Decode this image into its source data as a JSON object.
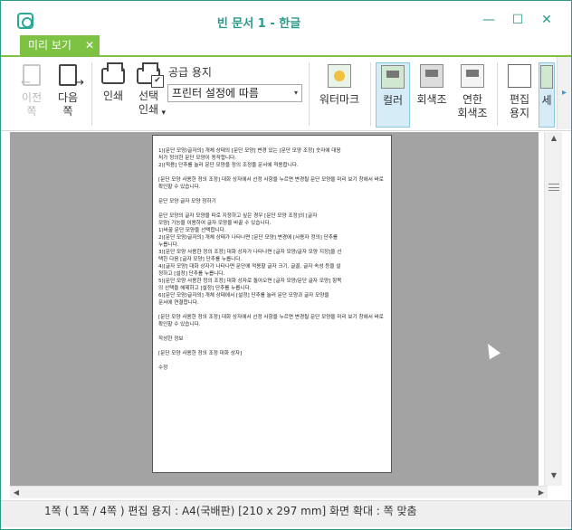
{
  "window": {
    "title": "빈 문서 1 - 한글",
    "controls": {
      "minimize": "—",
      "maximize": "☐",
      "close": "✕"
    }
  },
  "tab": {
    "label": "미리 보기",
    "close": "✕"
  },
  "ribbon": {
    "prev": "이전\n쪽",
    "next": "다음\n쪽",
    "print": "인쇄",
    "select_print": "선택\n인쇄",
    "paper_label": "공급 용지",
    "paper_value": "프린터 설정에 따름",
    "watermark": "워터마크",
    "color": "컬러",
    "grayscale": "회색조",
    "light_gray": "연한\n회색조",
    "edit_paper": "편집\n용지",
    "more": "세",
    "scroll_arrow": "▸",
    "dropdown_arrow": "▾"
  },
  "document_lines": [
    "1)[문단 모양/글자의] 개체 상태의 [문단 모양] 변경 있는 [문단 모양 조정] 숫자에 대응",
    "처가 정의한 문단 모양이 동작합니다.",
    "2)[적용] 단추를 눌러 문단 모양을 정의 조정을 문서에 적용합니다.",
    "",
    "[문단 모양 사용한 정의 조정] 대화 상자에서 선정 사항을 누르면 변경될 문단 모양을 미리 보기 창에서 바로 확인할 수 있습니다.",
    "",
    "문단 모양 글자 모양 정하기",
    "",
    "문단 모양의 글자 모양을 따로 지정하고 싶은 경우 [문단 모양 조정]의 [글자",
    "모양] 기능을 이용하여 글자 모양을 바꿀 수 있습니다.",
    "1)바꿀 문단 모양을 선택합니다.",
    "2)[문단 모양/글자의] 개체 상태가 나타나면 [문단 모양] 변경에 [사용자 정의] 단추를",
    "누릅니다.",
    "3)[문단 모양 사용한 정의 조정] 대화 상자가 나타나면 [글자 모양/글자 모양 지정]을 선",
    "택한 다음 [글자 모양] 단추를 누릅니다.",
    "4)[글자 모양] 대화 상자가 나타나면 문단에 적용할 글자 크기, 글꼴, 글자 속성 등을 설",
    "정하고 [설정] 단추를 누릅니다.",
    "5)[문단 모양 사용한 정의 조정] 대화 상자로 돌아오면 [글자 모양/문단 글자 모양] 항목",
    "의 선택을 해제하고 [설정] 단추를 누릅니다.",
    "6)[문단 모양/글자의] 개체 상태에서 [설정] 단추를 눌러 문단 모양과 글자 모양을",
    "문서에 연결합니다.",
    "",
    "[문단 모양 사용한 정의 조정] 대화 상자에서 선정 사항을 누르면 변경될 문단 모양을 미리 보기 창에서 바로 확인할 수 있습니다.",
    "",
    "작성한 정보",
    "",
    "[문단 모양 사용한 정의 조정 대화 상자]",
    "",
    "수정"
  ],
  "statusbar": {
    "text": "1쪽 ( 1쪽 / 4쪽 ) 편집 용지 : A4(국배판)  [210 x 297 mm]  화면 확대 : 쪽 맞춤"
  },
  "scrollbars": {
    "up": "▲",
    "down": "▼",
    "left": "◀",
    "right": "▶"
  },
  "colors": {
    "accent": "#2a9a8a",
    "tab_green": "#7dc242",
    "preview_bg": "#a3a3a3"
  }
}
